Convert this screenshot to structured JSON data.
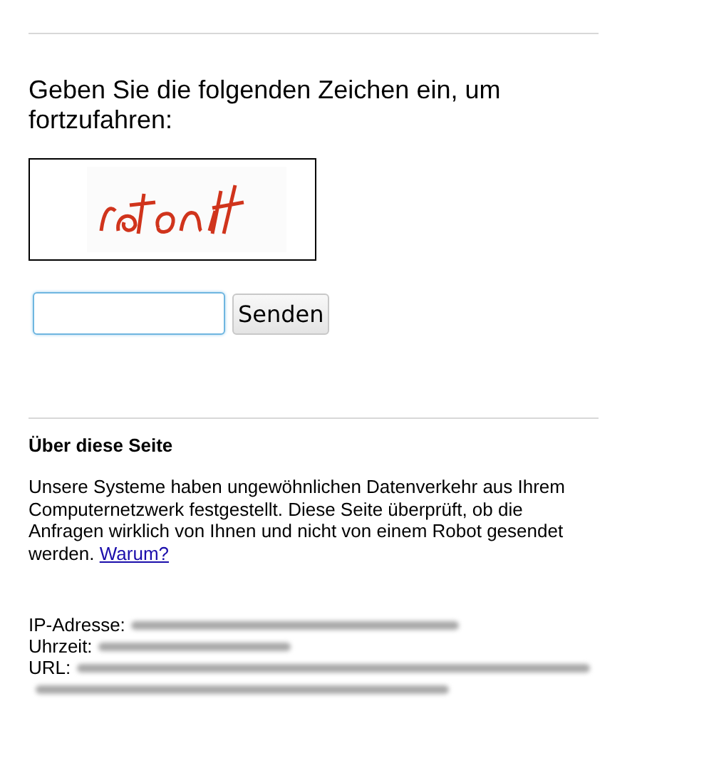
{
  "prompt": "Geben Sie die folgenden Zeichen ein, um fortzufahren:",
  "submit_button": "Senden",
  "about": {
    "title": "Über diese Seite",
    "text": "Unsere Systeme haben ungewöhnlichen Datenverkehr aus Ihrem Computernetzwerk festgestellt. Diese Seite überprüft, ob die Anfragen wirklich von Ihnen und nicht von einem Robot gesendet werden.",
    "link": "Warum?"
  },
  "details": [
    {
      "label": "IP-Adresse:"
    },
    {
      "label": "Uhrzeit:"
    },
    {
      "label": "URL:"
    }
  ]
}
